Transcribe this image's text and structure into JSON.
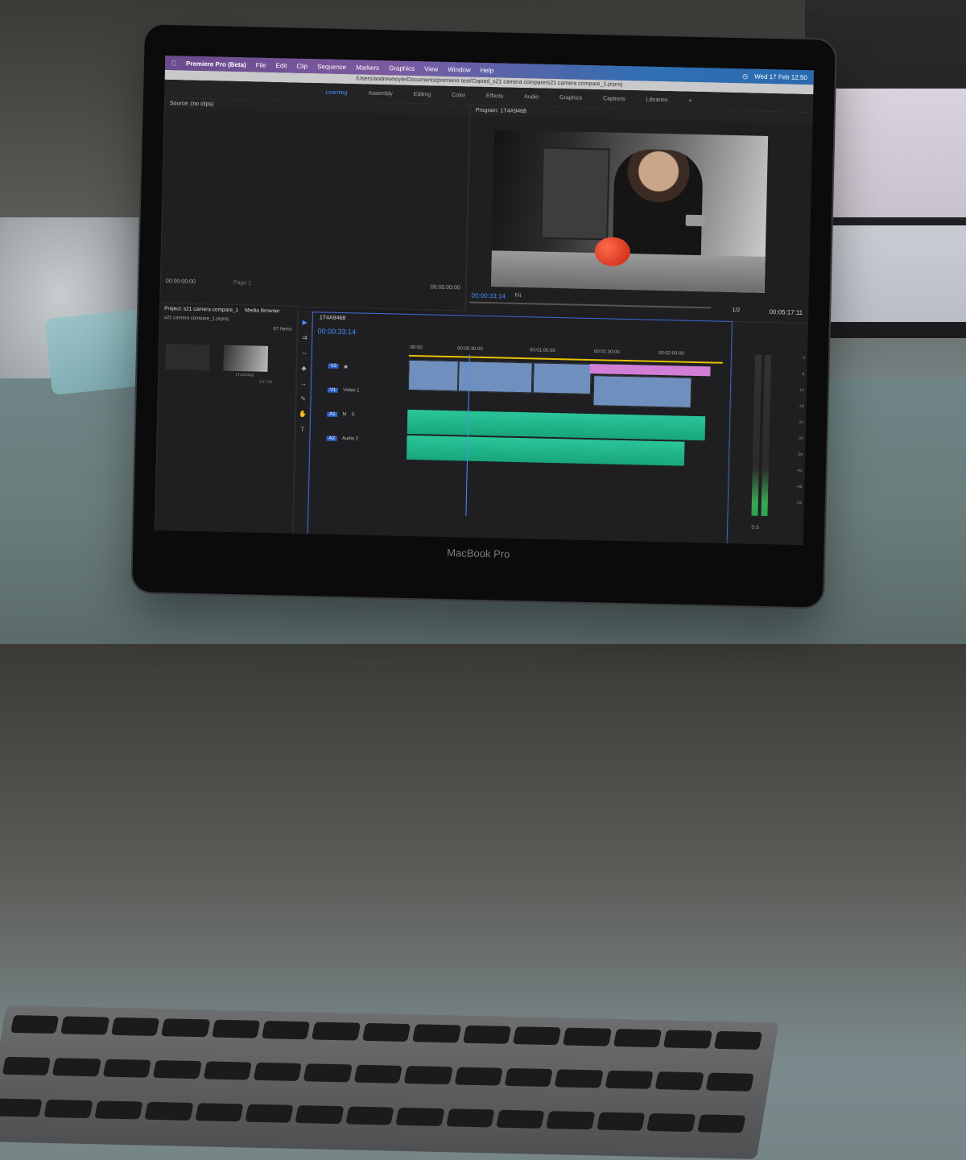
{
  "menubar": {
    "app_name": "Premiere Pro (Beta)",
    "items": [
      "File",
      "Edit",
      "Clip",
      "Sequence",
      "Markers",
      "Graphics",
      "View",
      "Window",
      "Help"
    ],
    "clock": "Wed 17 Feb  12:50"
  },
  "path": "/Users/andrewhoyle/Documents/premiere test/Copied_s21 camera compare/s21 camera compare_1.prproj",
  "workspaces": [
    "Learning",
    "Assembly",
    "Editing",
    "Color",
    "Effects",
    "Audio",
    "Graphics",
    "Captions",
    "Libraries"
  ],
  "source": {
    "title": "Source: (no clips)",
    "in_tc": "00:00:00:00",
    "page": "Page 1",
    "out_tc": "00:00:00:00"
  },
  "program": {
    "title": "Program: 1T4A9468",
    "timecode": "00:00:33:14",
    "fit": "Fit",
    "ratio": "1/2",
    "duration": "00:05:17:11"
  },
  "project": {
    "tab_project": "Project: s21 camera compare_1",
    "tab_media": "Media Browser",
    "file": "s21 camera compare_1.prproj",
    "items_count": "67 Items",
    "thumb_label": "1T4A9468",
    "thumb_duration": "5:17:11"
  },
  "timeline": {
    "sequence": "1T4A9468",
    "timecode": "00:00:33:14",
    "ruler": [
      ":00:00",
      "00:00:30:00",
      "00:01:00:00",
      "00:01:30:00",
      "00:02:00:00"
    ],
    "tracks": [
      {
        "label": "V2",
        "name": ""
      },
      {
        "label": "V1",
        "name": "Video 1"
      },
      {
        "label": "A1",
        "name": ""
      },
      {
        "label": "A2",
        "name": "Audio 2"
      }
    ]
  },
  "meters": {
    "scale": [
      "0",
      "-6",
      "-12",
      "-18",
      "-24",
      "-30",
      "-36",
      "-42",
      "-48",
      "-54"
    ],
    "footer": "S   S"
  },
  "laptop": {
    "brand": "MacBook Pro"
  }
}
